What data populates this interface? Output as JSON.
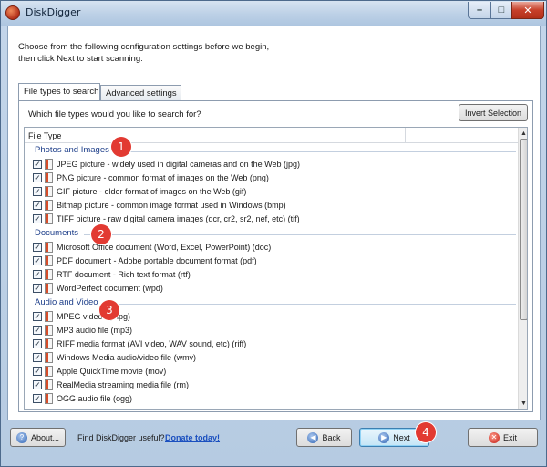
{
  "window": {
    "title": "DiskDigger"
  },
  "title_buttons": {
    "minimize": "–",
    "maximize": "□",
    "close": "✕"
  },
  "intro": {
    "line1": "Choose from the following configuration settings before we begin,",
    "line2": "then click Next to start scanning:"
  },
  "tabs": [
    {
      "label": "File types to search",
      "active": true
    },
    {
      "label": "Advanced settings",
      "active": false
    }
  ],
  "panel": {
    "question": "Which file types would you like to search for?",
    "invert_label": "Invert Selection",
    "column_header": "File Type"
  },
  "groups": [
    {
      "name": "Photos and Images",
      "badge": "1",
      "items": [
        {
          "label": "JPEG picture - widely used in digital cameras and on the Web (jpg)",
          "checked": true
        },
        {
          "label": "PNG picture - common format of images on the Web (png)",
          "checked": true
        },
        {
          "label": "GIF picture - older format of images on the Web (gif)",
          "checked": true
        },
        {
          "label": "Bitmap picture - common image format used in Windows (bmp)",
          "checked": true
        },
        {
          "label": "TIFF picture - raw digital camera images (dcr, cr2, sr2, nef, etc) (tif)",
          "checked": true
        }
      ]
    },
    {
      "name": "Documents",
      "badge": "2",
      "items": [
        {
          "label": "Microsoft Office document (Word, Excel, PowerPoint) (doc)",
          "checked": true
        },
        {
          "label": "PDF document - Adobe portable document format (pdf)",
          "checked": true
        },
        {
          "label": "RTF document - Rich text format (rtf)",
          "checked": true
        },
        {
          "label": "WordPerfect document (wpd)",
          "checked": true
        }
      ]
    },
    {
      "name": "Audio and Video",
      "badge": "3",
      "items": [
        {
          "label": "MPEG videos (mpg)",
          "checked": true
        },
        {
          "label": "MP3 audio file (mp3)",
          "checked": true
        },
        {
          "label": "RIFF media format (AVI video, WAV sound, etc) (riff)",
          "checked": true
        },
        {
          "label": "Windows Media audio/video file (wmv)",
          "checked": true
        },
        {
          "label": "Apple QuickTime movie (mov)",
          "checked": true
        },
        {
          "label": "RealMedia streaming media file (rm)",
          "checked": true
        },
        {
          "label": "OGG audio file (ogg)",
          "checked": true
        }
      ]
    }
  ],
  "scroll": {
    "position_fraction": 0.0,
    "visible_fraction": 0.7
  },
  "footer": {
    "about_label": "About...",
    "find_text": "Find DiskDigger useful?",
    "donate_label": "Donate today!",
    "back_label": "Back",
    "next_label": "Next",
    "exit_label": "Exit",
    "next_badge": "4"
  },
  "colors": {
    "badge": "#e23a32",
    "group_header": "#1e3f8a",
    "link": "#1a4fbf"
  }
}
